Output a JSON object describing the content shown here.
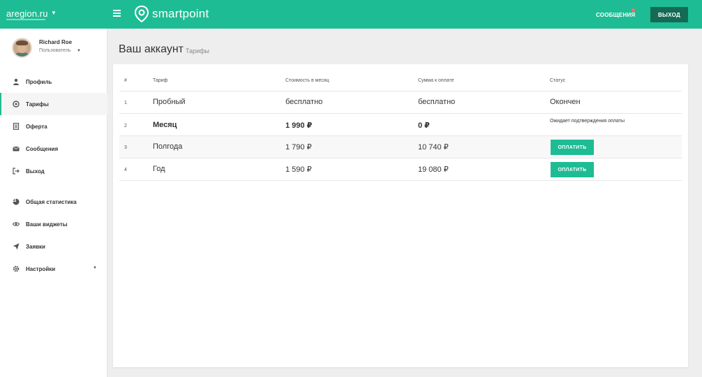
{
  "topbar": {
    "brand": "aregion.ru",
    "logo_text": "smartpoint",
    "messages_label": "СООБЩЕНИЯ",
    "logout_label": "ВЫХОД",
    "accent_color": "#1ebc94",
    "logout_color": "#136b55",
    "notification_color": "#ff6b6b"
  },
  "user": {
    "name": "Richard Roe",
    "role": "Пользователь"
  },
  "sidebar": {
    "items": [
      {
        "label": "Профиль",
        "icon": "person-icon"
      },
      {
        "label": "Тарифы",
        "icon": "tariff-icon",
        "active": true
      },
      {
        "label": "Оферта",
        "icon": "document-icon"
      },
      {
        "label": "Сообщения",
        "icon": "envelope-icon"
      },
      {
        "label": "Выход",
        "icon": "logout-icon"
      }
    ],
    "items2": [
      {
        "label": "Общая статистика",
        "icon": "pie-chart-icon"
      },
      {
        "label": "Ваши виджеты",
        "icon": "eye-icon"
      },
      {
        "label": "Заявки",
        "icon": "paper-plane-icon"
      },
      {
        "label": "Настройки",
        "icon": "gear-icon"
      }
    ]
  },
  "page": {
    "title": "Ваш аккаунт",
    "breadcrumb": "Тарифы"
  },
  "table": {
    "headers": [
      "#",
      "Тариф",
      "Стоимость в месяц",
      "Сумма к оплате",
      "Статус"
    ],
    "rows": [
      {
        "num": "1",
        "tariff": "Пробный",
        "price": "бесплатно",
        "total": "бесплатно",
        "status": "Окончен"
      },
      {
        "num": "2",
        "tariff": "Месяц",
        "price": "1 990 ₽",
        "total": "0 ₽",
        "status": "Ожидает подтверждения оплаты"
      },
      {
        "num": "3",
        "tariff": "Полгода",
        "price": "1 790 ₽",
        "total": "10 740 ₽",
        "action": "ОПЛАТИТЬ"
      },
      {
        "num": "4",
        "tariff": "Год",
        "price": "1 590 ₽",
        "total": "19 080 ₽",
        "action": "ОПЛАТИТЬ"
      }
    ]
  }
}
